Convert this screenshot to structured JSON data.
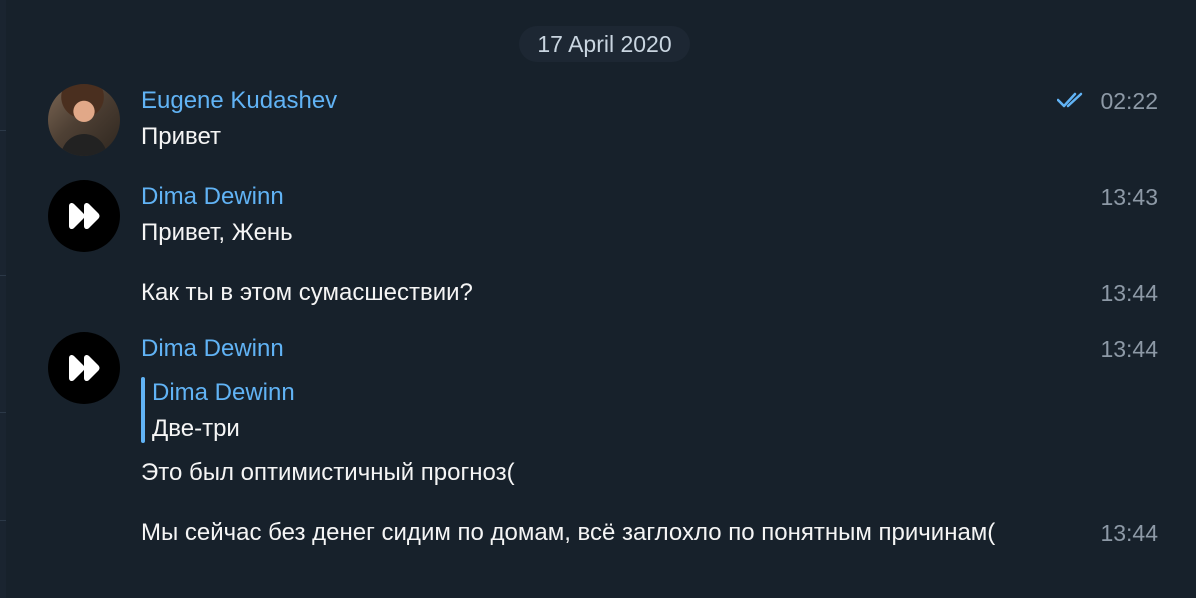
{
  "chat": {
    "date": "17 April 2020",
    "messages": [
      {
        "sender": "Eugene Kudashev",
        "text": "Привет",
        "time": "02:22",
        "avatar_icon": "profile-photo-icon",
        "status": "read"
      },
      {
        "sender": "Dima Dewinn",
        "text": "Привет, Жень",
        "time": "13:43",
        "avatar_icon": "forward-double-arrow-icon"
      },
      {
        "text": "Как ты в этом сумасшествии?",
        "time": "13:44"
      },
      {
        "sender": "Dima Dewinn",
        "time": "13:44",
        "avatar_icon": "forward-double-arrow-icon",
        "reply": {
          "sender": "Dima Dewinn",
          "text": "Две-три"
        },
        "text": "Это был оптимистичный прогноз("
      },
      {
        "text": "Мы сейчас без денег сидим по домам, всё заглохло по понятным причинам(",
        "time": "13:44"
      }
    ]
  },
  "colors": {
    "background": "#17212b",
    "accent": "#61b3f5",
    "text": "#f5f5f5",
    "muted": "#8d99a6"
  }
}
